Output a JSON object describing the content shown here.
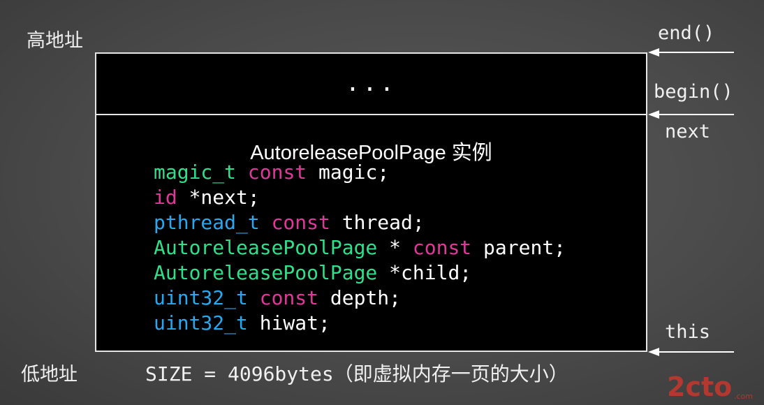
{
  "labels": {
    "high_address": "高地址",
    "low_address": "低地址"
  },
  "pointers": {
    "end": "end()",
    "begin": "begin()",
    "next": "next",
    "this": "this"
  },
  "box": {
    "ellipsis": "...",
    "title": "AutoreleasePoolPage 实例",
    "code_lines": [
      [
        {
          "t": "magic_t",
          "c": "green"
        },
        {
          "t": " "
        },
        {
          "t": "const",
          "c": "pink"
        },
        {
          "t": " magic;",
          "c": "white"
        }
      ],
      [
        {
          "t": "id",
          "c": "pink"
        },
        {
          "t": " *next;",
          "c": "white"
        }
      ],
      [
        {
          "t": "pthread_t",
          "c": "blue"
        },
        {
          "t": " "
        },
        {
          "t": "const",
          "c": "pink"
        },
        {
          "t": " thread;",
          "c": "white"
        }
      ],
      [
        {
          "t": "AutoreleasePoolPage",
          "c": "green"
        },
        {
          "t": " * ",
          "c": "white"
        },
        {
          "t": "const",
          "c": "pink"
        },
        {
          "t": " parent;",
          "c": "white"
        }
      ],
      [
        {
          "t": "AutoreleasePoolPage",
          "c": "green"
        },
        {
          "t": " *child;",
          "c": "white"
        }
      ],
      [
        {
          "t": "uint32_t",
          "c": "blue"
        },
        {
          "t": " "
        },
        {
          "t": "const",
          "c": "pink"
        },
        {
          "t": " depth;",
          "c": "white"
        }
      ],
      [
        {
          "t": "uint32_t",
          "c": "blue"
        },
        {
          "t": " hiwat;",
          "c": "white"
        }
      ]
    ]
  },
  "size_caption": {
    "mono": "SIZE = 4096bytes",
    "cjk": "（即虚拟内存一页的大小）"
  },
  "watermark": {
    "text": "2cto",
    "suffix": ".com"
  },
  "colors": {
    "type_green": "#2fe08a",
    "keyword_pink": "#e0389a",
    "type_blue": "#28a8f0",
    "watermark_red": "#d9352b"
  }
}
